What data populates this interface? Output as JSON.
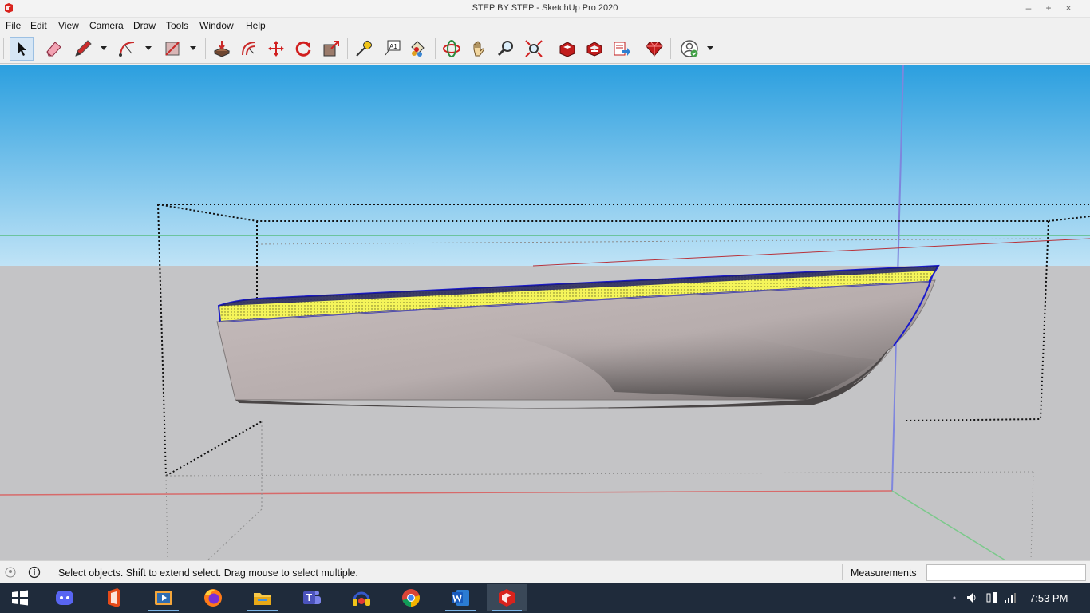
{
  "window": {
    "title": "STEP BY STEP - SketchUp Pro 2020",
    "controls": {
      "minimize": "–",
      "maximize": "+",
      "close": "×"
    }
  },
  "menu": [
    {
      "label": "File",
      "key": "file"
    },
    {
      "label": "Edit",
      "key": "edit"
    },
    {
      "label": "View",
      "key": "view"
    },
    {
      "label": "Camera",
      "key": "camera"
    },
    {
      "label": "Draw",
      "key": "draw"
    },
    {
      "label": "Tools",
      "key": "tools"
    },
    {
      "label": "Window",
      "key": "window"
    },
    {
      "label": "Help",
      "key": "help"
    }
  ],
  "toolbar": {
    "tools": [
      {
        "name": "select-tool",
        "icon": "cursor-arrow-icon",
        "active": true
      },
      {
        "name": "eraser-tool",
        "icon": "eraser-icon"
      },
      {
        "name": "line-tool",
        "icon": "pencil-icon"
      },
      {
        "name": "arc-tool",
        "icon": "arc-icon"
      },
      {
        "name": "rectangle-tool",
        "icon": "rectangle-icon"
      },
      {
        "name": "push-pull-tool",
        "icon": "push-pull-icon"
      },
      {
        "name": "offset-tool",
        "icon": "offset-icon"
      },
      {
        "name": "move-tool",
        "icon": "move-icon"
      },
      {
        "name": "rotate-tool",
        "icon": "rotate-icon"
      },
      {
        "name": "scale-tool",
        "icon": "scale-icon"
      },
      {
        "name": "tape-measure-tool",
        "icon": "tape-measure-icon"
      },
      {
        "name": "text-tool",
        "icon": "text-label-icon",
        "label": "A1"
      },
      {
        "name": "paint-bucket-tool",
        "icon": "paint-bucket-icon"
      },
      {
        "name": "orbit-tool",
        "icon": "orbit-icon"
      },
      {
        "name": "pan-tool",
        "icon": "hand-icon"
      },
      {
        "name": "zoom-tool",
        "icon": "magnifier-icon"
      },
      {
        "name": "zoom-extents-tool",
        "icon": "zoom-extents-icon"
      },
      {
        "name": "3d-warehouse-button",
        "icon": "warehouse-icon"
      },
      {
        "name": "extension-warehouse-button",
        "icon": "extension-warehouse-icon"
      },
      {
        "name": "send-to-layout-button",
        "icon": "layout-icon"
      },
      {
        "name": "ruby-console-button",
        "icon": "ruby-gem-icon"
      },
      {
        "name": "account-button",
        "icon": "user-account-icon"
      }
    ]
  },
  "viewport": {
    "sky_top": "#2b9fdf",
    "sky_bottom": "#bfe3f6",
    "ground": "#c4c4c6",
    "axes": {
      "red": "#c0392b",
      "green": "#2eaf4a",
      "blue": "#6f78d8"
    },
    "hull_color": "#b8aeae",
    "deck_color": "#f5f55a",
    "sheer_line_color": "#1a1acc"
  },
  "status": {
    "message": "Select objects. Shift to extend select. Drag mouse to select multiple.",
    "measurements_label": "Measurements",
    "measurements_value": ""
  },
  "taskbar": {
    "apps": [
      {
        "name": "start-button",
        "icon": "windows-logo-icon"
      },
      {
        "name": "discord-app",
        "icon": "discord-icon"
      },
      {
        "name": "office-app",
        "icon": "office-icon"
      },
      {
        "name": "media-player-app",
        "icon": "media-player-icon"
      },
      {
        "name": "firefox-app",
        "icon": "firefox-icon"
      },
      {
        "name": "file-explorer-app",
        "icon": "folder-icon"
      },
      {
        "name": "teams-app",
        "icon": "teams-icon"
      },
      {
        "name": "audio-app",
        "icon": "headphones-icon"
      },
      {
        "name": "chrome-app",
        "icon": "chrome-icon"
      },
      {
        "name": "word-app",
        "icon": "word-icon"
      },
      {
        "name": "sketchup-app",
        "icon": "sketchup-icon",
        "active": true
      }
    ],
    "clock": "7:53 PM"
  }
}
